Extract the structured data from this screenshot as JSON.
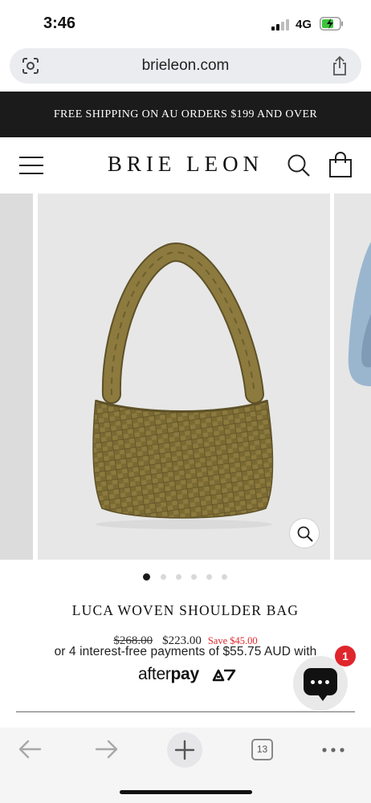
{
  "status_bar": {
    "time": "3:46",
    "network": "4G"
  },
  "browser": {
    "url": "brieleon.com",
    "tab_count": "13"
  },
  "promo": {
    "text": "FREE SHIPPING ON AU ORDERS $199 AND OVER"
  },
  "header": {
    "logo": "BRIE LEON"
  },
  "gallery": {
    "slide_count": 6,
    "active_index": 0
  },
  "product": {
    "title": "LUCA WOVEN SHOULDER BAG",
    "original_price": "$268.00",
    "sale_price": "$223.00",
    "savings": "Save $45.00",
    "installments": "or 4 interest-free payments of $55.75 AUD with",
    "afterpay_logo_prefix": "after",
    "afterpay_logo_suffix": "pay"
  },
  "chat": {
    "badge_count": "1"
  },
  "colors": {
    "promo_bg": "#1b1b1b",
    "save_red": "#e0282e",
    "badge_red": "#e0252c",
    "bag_olive": "#8c7a3e"
  },
  "icons": [
    "lens-icon",
    "share-icon",
    "menu-icon",
    "search-icon",
    "cart-icon",
    "zoom-icon",
    "chat-icon",
    "back-icon",
    "forward-icon",
    "plus-icon",
    "tabs-icon",
    "more-icon"
  ]
}
